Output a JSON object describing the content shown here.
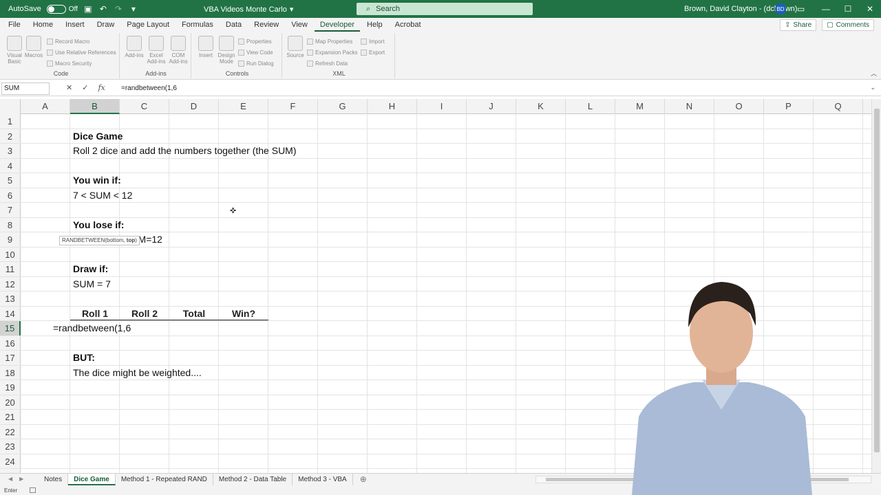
{
  "titlebar": {
    "autosave_label": "AutoSave",
    "autosave_state": "Off",
    "title": "VBA Videos Monte Carlo",
    "search_placeholder": "Search",
    "user_name": "Brown, David Clayton - (dcbrown)",
    "avatar_initials": "BD",
    "accent_color": "#217346"
  },
  "menu": {
    "tabs": [
      "File",
      "Home",
      "Insert",
      "Draw",
      "Page Layout",
      "Formulas",
      "Data",
      "Review",
      "View",
      "Developer",
      "Help",
      "Acrobat"
    ],
    "active_tab": "Developer",
    "share_label": "Share",
    "comments_label": "Comments"
  },
  "ribbon": {
    "code": {
      "label": "Code",
      "visual_basic": "Visual Basic",
      "macros": "Macros",
      "record_macro": "Record Macro",
      "use_relative": "Use Relative References",
      "macro_security": "Macro Security"
    },
    "addins": {
      "label": "Add-ins",
      "add_ins": "Add-ins",
      "excel_add_ins": "Excel Add-ins",
      "com_add_ins": "COM Add-ins"
    },
    "controls": {
      "label": "Controls",
      "insert": "Insert",
      "design_mode": "Design Mode",
      "properties": "Properties",
      "view_code": "View Code",
      "run_dialog": "Run Dialog"
    },
    "xml": {
      "label": "XML",
      "source": "Source",
      "map_properties": "Map Properties",
      "expansion_packs": "Expansion Packs",
      "refresh_data": "Refresh Data",
      "import": "Import",
      "export": "Export"
    }
  },
  "formula_bar": {
    "name_box": "SUM",
    "cancel": "✕",
    "enter": "✓",
    "fx": "fx",
    "formula": "=randbetween(1,6"
  },
  "grid": {
    "columns": [
      "A",
      "B",
      "C",
      "D",
      "E",
      "F",
      "G",
      "H",
      "I",
      "J",
      "K",
      "L",
      "M",
      "N",
      "O",
      "P",
      "Q"
    ],
    "selected_column": "B",
    "rows": [
      "1",
      "2",
      "3",
      "4",
      "5",
      "6",
      "7",
      "8",
      "9",
      "10",
      "11",
      "12",
      "13",
      "14",
      "15",
      "16",
      "17",
      "18",
      "19",
      "20",
      "21",
      "22",
      "23",
      "24",
      "25"
    ],
    "selected_row": "15",
    "cells": {
      "B2": "Dice Game",
      "B3": "Roll 2 dice and add the numbers together (the SUM)",
      "B5": "You win if:",
      "B6": "7 < SUM < 12",
      "B8": "You lose if:",
      "B9": "SUM < 7 or SUM=12",
      "B11": "Draw if:",
      "B12": "SUM = 7",
      "B14": "Roll 1",
      "C14": "Roll 2",
      "D14": "Total",
      "E14": "Win?",
      "B15": "=randbetween(1,6",
      "B17": "BUT:",
      "B18": "The dice might be weighted...."
    },
    "tooltip": {
      "prefix": "RANDBETWEEN(bottom, ",
      "bold_arg": "top",
      "suffix": ")"
    }
  },
  "sheets": {
    "tabs": [
      "Notes",
      "Dice Game",
      "Method 1 - Repeated RAND",
      "Method 2 - Data Table",
      "Method 3 - VBA"
    ],
    "active": "Dice Game"
  },
  "status": {
    "mode": "Enter"
  }
}
